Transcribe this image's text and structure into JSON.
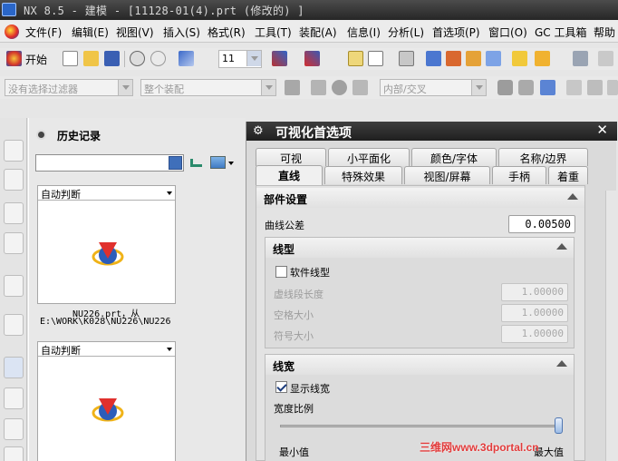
{
  "window": {
    "title": "NX 8.5 - 建模 - [11128-01(4).prt  (修改的) ]"
  },
  "menu": [
    "文件(F)",
    "编辑(E)",
    "视图(V)",
    "插入(S)",
    "格式(R)",
    "工具(T)",
    "装配(A)",
    "信息(I)",
    "分析(L)",
    "首选项(P)",
    "窗口(O)",
    "GC 工具箱",
    "帮助"
  ],
  "toolbar": {
    "start_label": "开始",
    "font_size_value": "11"
  },
  "selection_bar": {
    "filter_placeholder": "没有选择过滤器",
    "scope_value": "整个装配",
    "component_value": "内部/交叉"
  },
  "history": {
    "title": "历史记录",
    "cards": [
      {
        "mode": "自动判断",
        "caption_line1": "NU226.prt，从",
        "caption_line2": "E:\\WORK\\K028\\NU226\\NU226"
      },
      {
        "mode": "自动判断",
        "caption_line1": "",
        "caption_line2": ""
      }
    ]
  },
  "dialog": {
    "title": "可视化首选项",
    "tabs_row1": [
      "可视",
      "小平面化",
      "颜色/字体",
      "名称/边界"
    ],
    "tabs_row2": [
      "直线",
      "特殊效果",
      "视图/屏幕",
      "手柄",
      "着重"
    ],
    "active_tab": "直线",
    "section_part": "部件设置",
    "curve_tol_label": "曲线公差",
    "curve_tol_value": "0.00500",
    "linetype": {
      "title": "线型",
      "soft_label": "软件线型",
      "soft_checked": false,
      "dash_label": "虚线段长度",
      "dash_value": "1.00000",
      "space_label": "空格大小",
      "space_value": "1.00000",
      "symbol_label": "符号大小",
      "symbol_value": "1.00000"
    },
    "linewidth": {
      "title": "线宽",
      "show_label": "显示线宽",
      "show_checked": true,
      "ratio_label": "宽度比例",
      "slider_value": 1.0,
      "min_label": "最小值",
      "max_label": "最大值"
    }
  },
  "watermark": "三维网www.3dportal.cn"
}
